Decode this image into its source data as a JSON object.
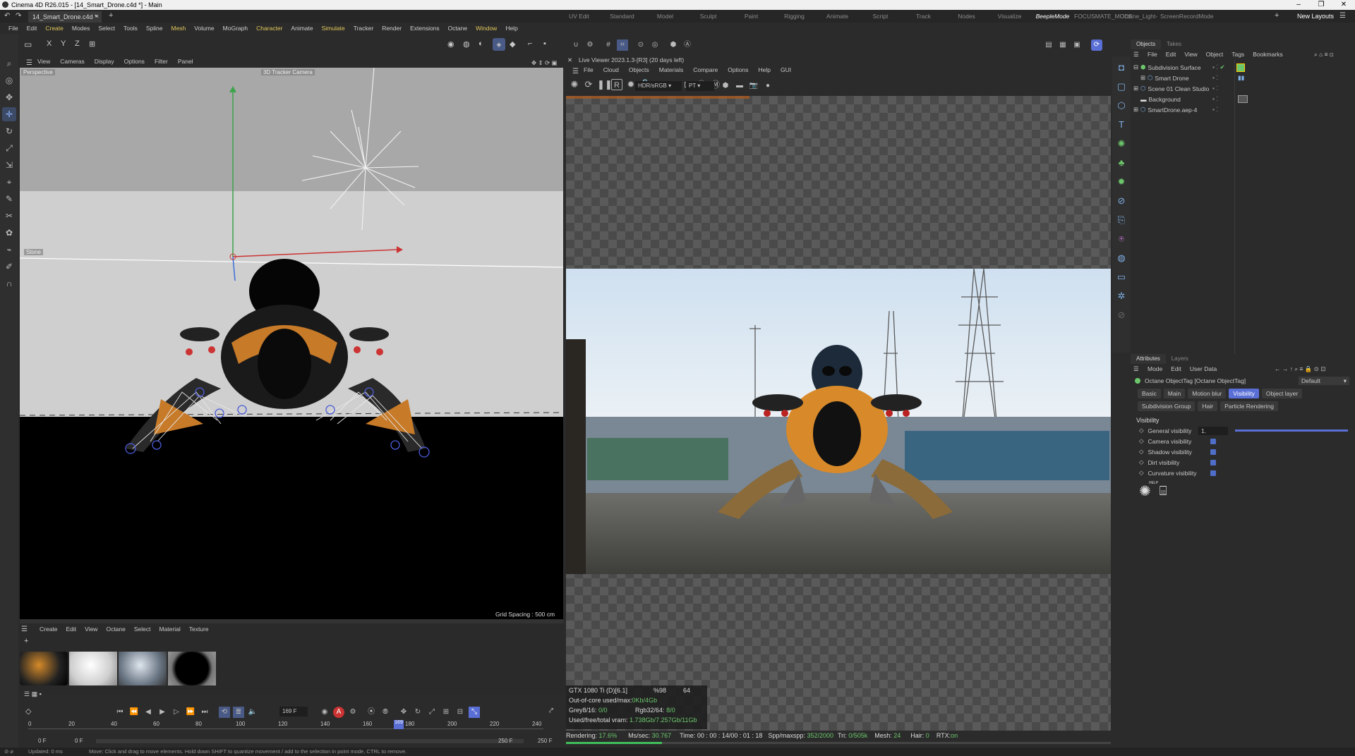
{
  "window": {
    "title": "Cinema 4D R26.015 - [14_Smart_Drone.c4d *] - Main"
  },
  "doc_tab": {
    "label": "14_Smart_Drone.c4d *"
  },
  "layouts": {
    "items": [
      "UV Edit",
      "Standard",
      "Model",
      "Sculpt",
      "Paint",
      "Rigging",
      "Animate",
      "Script",
      "Track",
      "Nodes",
      "Visualize",
      "BeepleMode",
      "FOCUSMATE_MODE",
      "Octane_Light-Texturing",
      "ScreenRecordMode"
    ],
    "active": "BeepleMode",
    "new_layouts": "New Layouts"
  },
  "menu": [
    "File",
    "Edit",
    "Create",
    "Modes",
    "Select",
    "Tools",
    "Spline",
    "Mesh",
    "Volume",
    "MoGraph",
    "Character",
    "Animate",
    "Simulate",
    "Tracker",
    "Render",
    "Extensions",
    "Octane",
    "Window",
    "Help"
  ],
  "viewport": {
    "menu": [
      "View",
      "Cameras",
      "Display",
      "Options",
      "Filter",
      "Panel"
    ],
    "name": "Perspective",
    "camera_label": "3D Tracker Camera",
    "stone_label": "Stone",
    "grid_spacing": "Grid Spacing : 500 cm",
    "axis_labels": [
      "X",
      "Y",
      "Z"
    ]
  },
  "material_manager": {
    "menu": [
      "Create",
      "Edit",
      "View",
      "Octane",
      "Select",
      "Material",
      "Texture"
    ]
  },
  "timeline": {
    "ticks": [
      "0",
      "20",
      "40",
      "60",
      "80",
      "100",
      "120",
      "140",
      "160",
      "180",
      "200",
      "220",
      "240"
    ],
    "current_frame": "169 F",
    "start_a": "0 F",
    "start_b": "0 F",
    "end_a": "250 F",
    "end_b": "250 F",
    "playhead": "169"
  },
  "status_bar": {
    "left": "Updated: 0 ms",
    "message": "Move: Click and drag to move elements. Hold down SHIFT to quantize movement / add to the selection in point mode, CTRL to remove."
  },
  "live_viewer": {
    "title": "Live Viewer 2023.1.3-[R3] (20 days left)",
    "menu": [
      "File",
      "Cloud",
      "Objects",
      "Materials",
      "Compare",
      "Options",
      "Help",
      "GUI"
    ],
    "color_mode": "HDR/sRGB",
    "kernel": "PT",
    "stats": {
      "gpu": "GTX 1080 Ti (D)[6.1]",
      "gpu_pct": "%98",
      "gpu_num": "64",
      "ooc_label": "Out-of-core used/max:",
      "ooc_val": "0Kb/4Gb",
      "grey_label": "Grey8/16:",
      "grey_val": "0/0",
      "rgb_label": "Rgb32/64:",
      "rgb_val": "8/0",
      "vram_label": "Used/free/total vram:",
      "vram_val": "1.738Gb/7.257Gb/11Gb"
    },
    "render": {
      "rendering_label": "Rendering:",
      "rendering_val": "17.6%",
      "ms_label": "Ms/sec:",
      "ms_val": "30.767",
      "time_label": "Time:",
      "time_val": "00 : 00 : 14/00 : 01 : 18",
      "spp_label": "Spp/maxspp:",
      "spp_val": "352/2000",
      "tri_label": "Tri:",
      "tri_val": "0/505k",
      "mesh_label": "Mesh:",
      "mesh_val": "24",
      "hair_label": "Hair:",
      "hair_val": "0",
      "rtx_label": "RTX:",
      "rtx_val": "on",
      "progress": 0.176
    }
  },
  "objects": {
    "tabs": [
      "Objects",
      "Takes"
    ],
    "menu": [
      "File",
      "Edit",
      "View",
      "Object",
      "Tags",
      "Bookmarks"
    ],
    "items": [
      {
        "name": "Subdivision Surface",
        "indent": 0
      },
      {
        "name": "Smart Drone",
        "indent": 1
      },
      {
        "name": "Scene 01 Clean Studio",
        "indent": 0
      },
      {
        "name": "Background",
        "indent": 0
      },
      {
        "name": "SmartDrone.aep-4",
        "indent": 0
      }
    ]
  },
  "attributes": {
    "tabs": [
      "Attributes",
      "Layers"
    ],
    "menu": [
      "Mode",
      "Edit",
      "User Data"
    ],
    "tag_title": "Octane ObjectTag [Octane ObjectTag]",
    "preset": "Default",
    "subtabs": [
      "Basic",
      "Main",
      "Motion blur",
      "Visibility",
      "Object layer",
      "Subdivision Group",
      "Hair",
      "Particle Rendering"
    ],
    "active_subtab": "Visibility",
    "section": "Visibility",
    "general_visibility_label": "General visibility",
    "general_visibility_value": "1.",
    "general_visibility_level": 1.0,
    "checks": [
      "Camera visibility",
      "Shadow visibility",
      "Dirt visibility",
      "Curvature visibility"
    ],
    "help_label": "HELP"
  },
  "colors": {
    "accent": "#5a6fd6",
    "progress": "#3fbf5a",
    "menu_highlight": "#e3c85b"
  }
}
